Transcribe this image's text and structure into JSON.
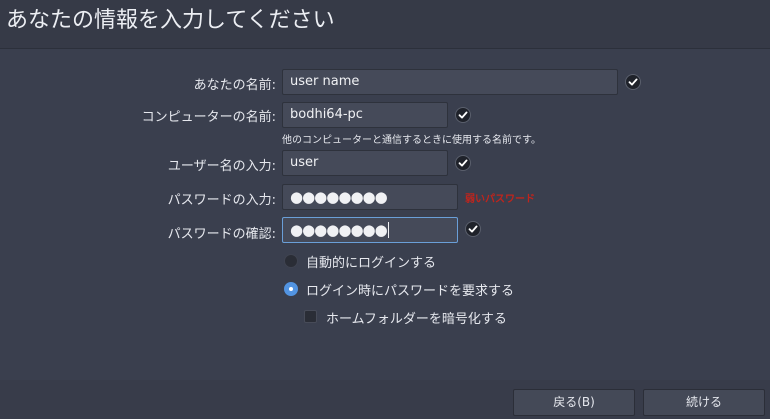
{
  "header": {
    "title": "あなたの情報を入力してください"
  },
  "form": {
    "name": {
      "label": "あなたの名前:",
      "value": "user name"
    },
    "computer": {
      "label": "コンピューターの名前:",
      "value": "bodhi64-pc",
      "hint": "他のコンピューターと通信するときに使用する名前です。"
    },
    "username": {
      "label": "ユーザー名の入力:",
      "value": "user"
    },
    "password": {
      "label": "パスワードの入力:",
      "value": "●●●●●●●●",
      "strength": "弱いパスワード"
    },
    "confirm": {
      "label": "パスワードの確認:",
      "value": "●●●●●●●●"
    }
  },
  "options": {
    "auto_login": {
      "label": "自動的にログインする",
      "checked": false
    },
    "require_password": {
      "label": "ログイン時にパスワードを要求する",
      "checked": true
    },
    "encrypt_home": {
      "label": "ホームフォルダーを暗号化する",
      "checked": false
    }
  },
  "buttons": {
    "back": "戻る(B)",
    "continue": "続ける"
  },
  "colors": {
    "background": "#3a3f4e",
    "accent": "#5294e2",
    "warning": "#c0241c"
  }
}
